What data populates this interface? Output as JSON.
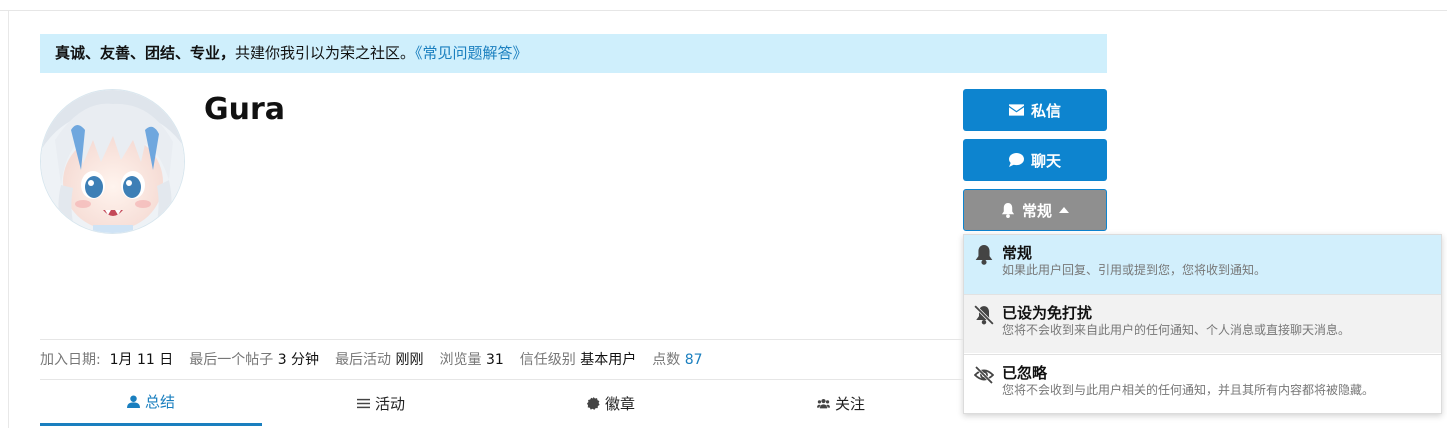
{
  "notice": {
    "bold_text": "真诚、友善、团结、专业，",
    "text": "共建你我引以为荣之社区。",
    "link_text": "《常见问题解答》"
  },
  "profile": {
    "username": "Gura"
  },
  "buttons": {
    "message": "私信",
    "chat": "聊天",
    "notify": "常规"
  },
  "dropdown": {
    "items": [
      {
        "title": "常规",
        "desc": "如果此用户回复、引用或提到您，您将收到通知。",
        "icon": "bell-icon"
      },
      {
        "title": "已设为免打扰",
        "desc": "您将不会收到来自此用户的任何通知、个人消息或直接聊天消息。",
        "icon": "bell-slash-icon"
      },
      {
        "title": "已忽略",
        "desc": "您将不会收到与此用户相关的任何通知，并且其所有内容都将被隐藏。",
        "icon": "eye-slash-icon"
      }
    ]
  },
  "stats": {
    "joined_label": "加入日期:",
    "joined_value": "1月 11 日",
    "last_post_label": "最后一个帖子",
    "last_post_value": "3 分钟",
    "last_activity_label": "最后活动",
    "last_activity_value": "刚刚",
    "views_label": "浏览量",
    "views_value": "31",
    "trust_label": "信任级别",
    "trust_value": "基本用户",
    "points_label": "点数",
    "points_value": "87"
  },
  "tabs": [
    {
      "label": "总结",
      "icon": "user-icon",
      "active": true
    },
    {
      "label": "活动",
      "icon": "list-icon",
      "active": false
    },
    {
      "label": "徽章",
      "icon": "certificate-icon",
      "active": false
    },
    {
      "label": "关注",
      "icon": "users-icon",
      "active": false
    }
  ],
  "colors": {
    "accent": "#0d84cf",
    "notice_bg": "#cfeffc",
    "link": "#1a7fbf"
  }
}
